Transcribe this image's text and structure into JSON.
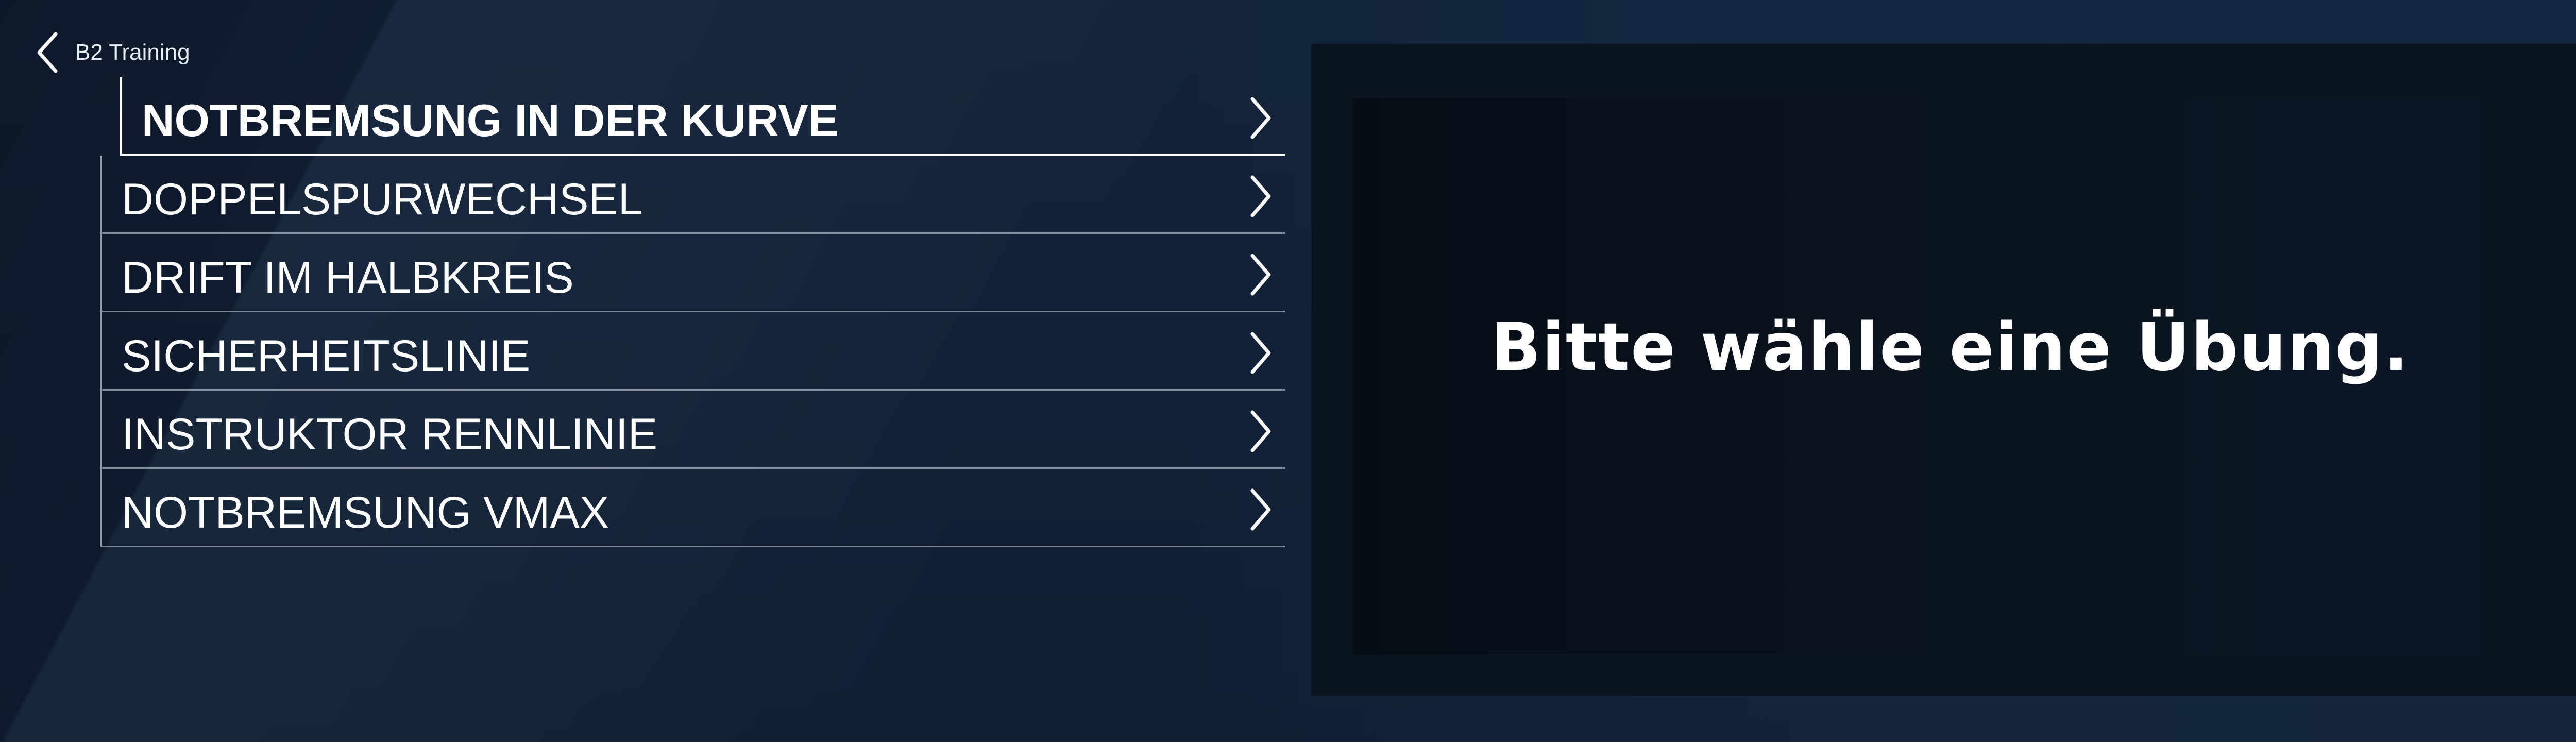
{
  "header": {
    "breadcrumb": "B2 Training",
    "back_icon": "chevron-left-icon"
  },
  "menu": {
    "items": [
      {
        "label": "NOTBREMSUNG IN DER KURVE",
        "selected": true,
        "icon": "chevron-right-icon"
      },
      {
        "label": "DOPPELSPURWECHSEL",
        "selected": false,
        "icon": "chevron-right-icon"
      },
      {
        "label": "DRIFT IM HALBKREIS",
        "selected": false,
        "icon": "chevron-right-icon"
      },
      {
        "label": "SICHERHEITSLINIE",
        "selected": false,
        "icon": "chevron-right-icon"
      },
      {
        "label": "INSTRUKTOR RENNLINIE",
        "selected": false,
        "icon": "chevron-right-icon"
      },
      {
        "label": "NOTBREMSUNG VMAX",
        "selected": false,
        "icon": "chevron-right-icon"
      }
    ]
  },
  "preview": {
    "message": "Bitte wähle eine Übung."
  },
  "colors": {
    "background": "#132236",
    "panel_outer": "#0b1522",
    "panel_inner": "#070d15",
    "text": "#ffffff",
    "divider": "#dce4f0"
  }
}
